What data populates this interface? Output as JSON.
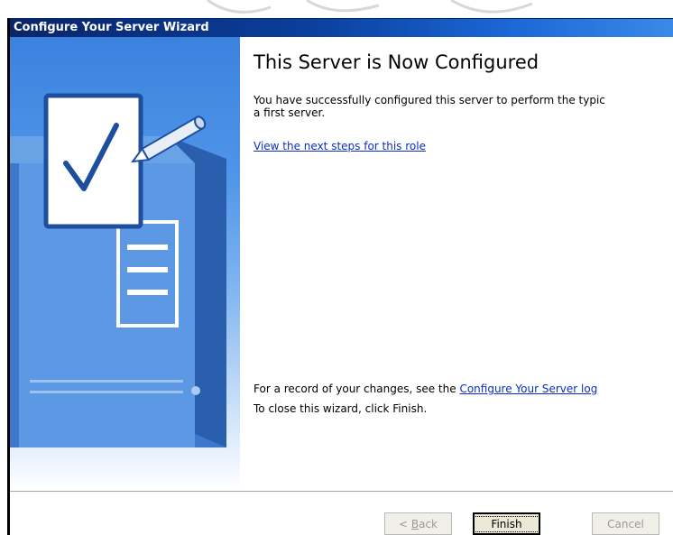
{
  "window": {
    "title": "Configure Your Server Wizard"
  },
  "content": {
    "heading": "This Server is Now Configured",
    "intro_line1": "You have successfully configured this server to perform the typic",
    "intro_line2": "a first server.",
    "next_steps_link": "View the next steps for this role",
    "record_prefix": "For a record of your changes, see the ",
    "record_link": "Configure Your Server log",
    "close_text": "To close this wizard, click Finish."
  },
  "buttons": {
    "back_prefix": "< ",
    "back_accel": "B",
    "back_rest": "ack",
    "finish": "Finish",
    "cancel": "Cancel"
  },
  "banner": {
    "icon": "server-checkmark-illustration-icon"
  },
  "colors": {
    "titlebar": "#0a246a",
    "link": "#0b2fc5",
    "banner_top": "#3b82df"
  }
}
